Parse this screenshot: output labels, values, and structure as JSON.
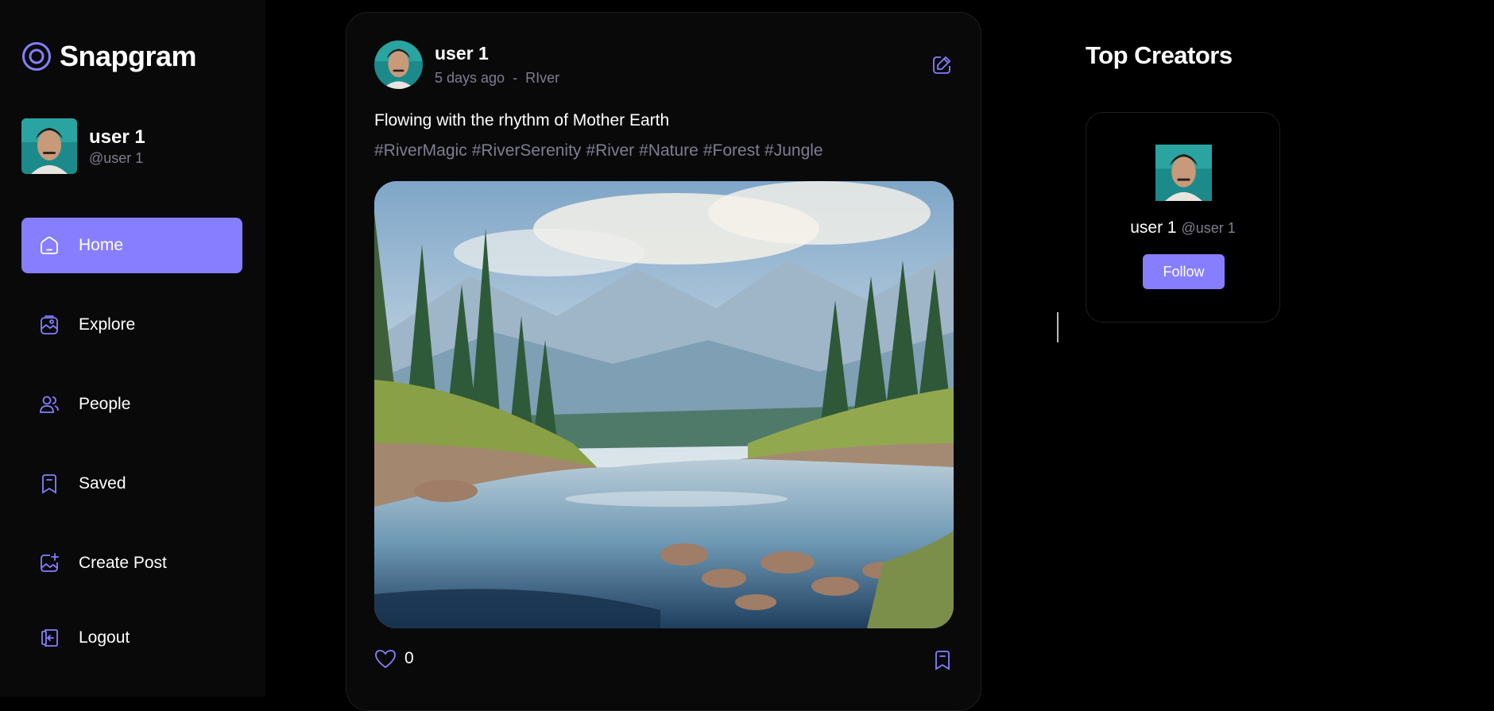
{
  "app": {
    "name": "Snapgram",
    "logo_icon": "instagram-ring-icon",
    "accent_color": "#877eff",
    "muted_color": "#7e7e92"
  },
  "current_user": {
    "name": "user 1",
    "handle": "@user 1"
  },
  "nav": {
    "items": [
      {
        "label": "Home",
        "icon": "home-icon",
        "active": true
      },
      {
        "label": "Explore",
        "icon": "explore-icon",
        "active": false
      },
      {
        "label": "People",
        "icon": "people-icon",
        "active": false
      },
      {
        "label": "Saved",
        "icon": "bookmark-icon",
        "active": false
      },
      {
        "label": "Create Post",
        "icon": "gallery-add-icon",
        "active": false
      },
      {
        "label": "Logout",
        "icon": "logout-icon",
        "active": false
      }
    ]
  },
  "post": {
    "author": "user 1",
    "time": "5 days ago",
    "separator": "-",
    "location": "RIver",
    "caption": "Flowing with the rhythm of Mother Earth",
    "tags": [
      "#RiverMagic",
      "#RiverSerenity",
      "#River",
      "#Nature",
      "#Forest",
      "#Jungle"
    ],
    "likes": "0",
    "edit_icon": "edit-icon",
    "like_icon": "heart-icon",
    "save_icon": "bookmark-icon"
  },
  "top_creators": {
    "title": "Top Creators",
    "creators": [
      {
        "name": "user 1",
        "handle": "@user 1",
        "button": "Follow"
      }
    ]
  }
}
